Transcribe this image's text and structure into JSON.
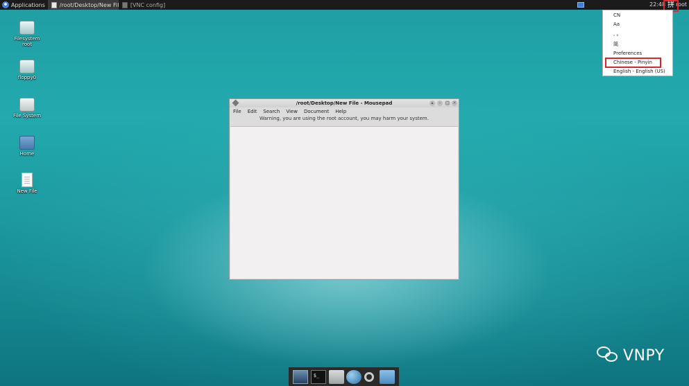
{
  "top_panel": {
    "applications_label": "Applications",
    "tasks": [
      {
        "label": "/root/Desktop/New Fil..."
      },
      {
        "label": "[VNC config]"
      }
    ],
    "clock": "22:48",
    "ime_glyph": "拼",
    "user": "root"
  },
  "ime_menu": {
    "items": [
      "CN",
      "Aa",
      ", 。",
      "简",
      "Preferences",
      "Chinese - Pinyin",
      "English - English (US)"
    ]
  },
  "desktop_icons": [
    {
      "label": "Filesystem root"
    },
    {
      "label": "floppy0"
    },
    {
      "label": "File System"
    },
    {
      "label": "Home"
    },
    {
      "label": "New File"
    }
  ],
  "window": {
    "title": "/root/Desktop/New File - Mousepad",
    "menu": [
      "File",
      "Edit",
      "Search",
      "View",
      "Document",
      "Help"
    ],
    "warning": "Warning, you are using the root account, you may harm your system."
  },
  "watermark": {
    "text": "VNPY"
  },
  "colors": {
    "panel": "#1b1b1b",
    "highlight": "#d8242b",
    "accent": "#3d7fd6"
  }
}
